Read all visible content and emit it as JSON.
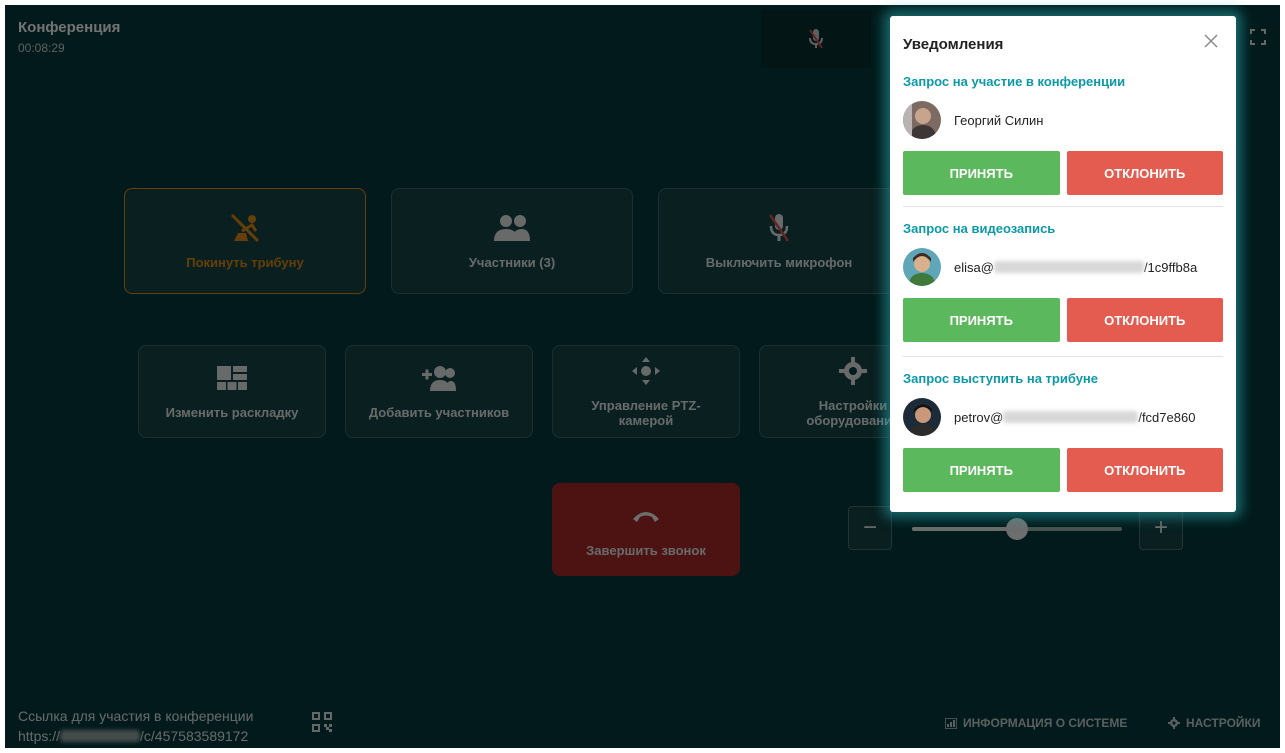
{
  "conference": {
    "title": "Конференция",
    "timer": "00:08:29"
  },
  "tiles": {
    "leave": "Покинуть трибуну",
    "participants": "Участники (3)",
    "mute": "Выключить микрофон",
    "layout": "Изменить раскладку",
    "add": "Добавить участников",
    "ptz": "Управление PTZ-камерой",
    "equipment": "Настройки оборудования",
    "end_call": "Завершить звонок"
  },
  "zoom": {
    "minus": "−",
    "plus": "+",
    "level": 0.5
  },
  "footer": {
    "link_label": "Ссылка для участия в конференции",
    "link_prefix": "https://",
    "link_suffix": "/c/457583589172",
    "system_info": "ИНФОРМАЦИЯ О СИСТЕМЕ",
    "settings": "НАСТРОЙКИ"
  },
  "notifications": {
    "title": "Уведомления",
    "requests": [
      {
        "type": "Запрос на участие в конференции",
        "name": "Георгий Силин",
        "name_suffix": "",
        "accept": "ПРИНЯТЬ",
        "reject": "ОТКЛОНИТЬ"
      },
      {
        "type": "Запрос на видеозапись",
        "name": "elisa@",
        "name_suffix": "/1c9ffb8a",
        "accept": "ПРИНЯТЬ",
        "reject": "ОТКЛОНИТЬ"
      },
      {
        "type": "Запрос выступить на трибуне",
        "name": "petrov@",
        "name_suffix": "/fcd7e860",
        "accept": "ПРИНЯТЬ",
        "reject": "ОТКЛОНИТЬ"
      }
    ]
  },
  "colors": {
    "background": "#063a3d",
    "accent": "#0c9aa8",
    "accept": "#5cb85c",
    "reject": "#e45b4f",
    "leave": "#e08a12"
  }
}
